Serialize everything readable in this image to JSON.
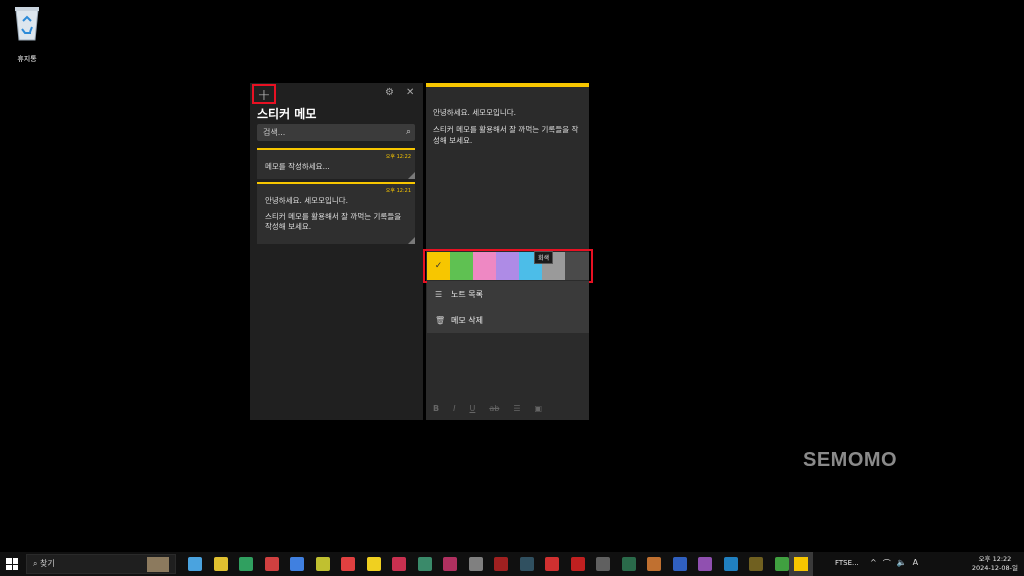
{
  "desktop": {
    "recycle_bin_label": "휴지통"
  },
  "list_window": {
    "title": "스티커 메모",
    "search_placeholder": "검색...",
    "notes": [
      {
        "time": "오후 12:22",
        "text": "메모를 작성하세요..."
      },
      {
        "time": "오후 12:21",
        "line1": "안녕하세요. 세모모입니다.",
        "line2": "스티커 메모를 활용해서 잘 까먹는 기록들을 작성해 보세요."
      }
    ]
  },
  "note_window": {
    "line1": "안녕하세요. 세모모입니다.",
    "line2": "스티커 메모를 활용해서 잘 까먹는 기록들을 작성해 보세요.",
    "colors": [
      "#f7c600",
      "#5fc152",
      "#ee88c3",
      "#ae8be6",
      "#4cbde8",
      "#9a9a9a",
      "#4a4a4a"
    ],
    "selected_color_index": 0,
    "tooltip": "회색",
    "menu": {
      "notes_list": "노트 목록",
      "delete": "메모 삭제"
    },
    "format_bar": [
      "B",
      "I",
      "U",
      "ab",
      "☰",
      "▣"
    ]
  },
  "watermark": "SEMOMO",
  "taskbar": {
    "search_label": "찾기",
    "ftse_label": "FTSE...",
    "clock_time": "오후 12:22",
    "clock_date": "2024-12-08-일"
  }
}
